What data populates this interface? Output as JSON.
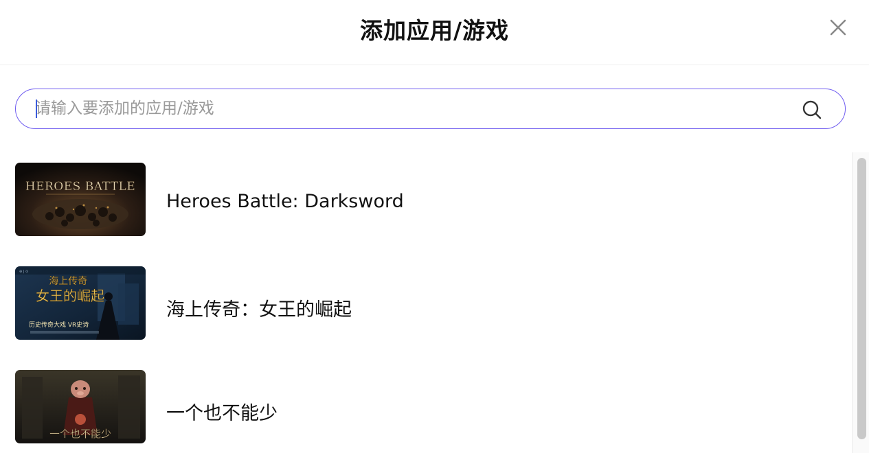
{
  "dialog": {
    "title": "添加应用/游戏",
    "close_icon": "close-icon"
  },
  "search": {
    "placeholder": "请输入要添加的应用/游戏",
    "value": "",
    "icon": "search-icon",
    "border_color": "#6f5cf0"
  },
  "items": [
    {
      "label": "Heroes Battle: Darksword",
      "thumb_text": "HEROES BATTLE"
    },
    {
      "label": "海上传奇：女王的崛起",
      "thumb_text": "海上传奇 女王的崛起",
      "thumb_subtext": "历史传奇大戏 VR史诗"
    },
    {
      "label": "一个也不能少",
      "thumb_text": "一个也不能少"
    }
  ],
  "colors": {
    "accent": "#6f5cf0",
    "caret": "#3b5bdb",
    "scrollbar": "#c9c9c9"
  }
}
